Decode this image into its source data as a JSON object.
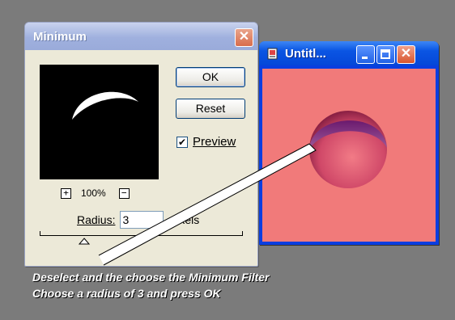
{
  "minimum_dialog": {
    "title": "Minimum",
    "close_label": "✕",
    "zoom_level": "100%",
    "zoom_in_label": "+",
    "zoom_out_label": "−",
    "ok_label": "OK",
    "reset_label": "Reset",
    "preview_label": "Preview",
    "preview_checked": true,
    "check_mark": "✔",
    "radius_label": "Radius:",
    "radius_value": "3",
    "unit_label": "pixels"
  },
  "document_window": {
    "title": "Untitl...",
    "close_label": "✕",
    "canvas_color": "#f17a7a"
  },
  "caption": {
    "line1": "Deselect and the choose the Minimum Filter",
    "line2": "Choose a radius of 3 and press OK"
  }
}
